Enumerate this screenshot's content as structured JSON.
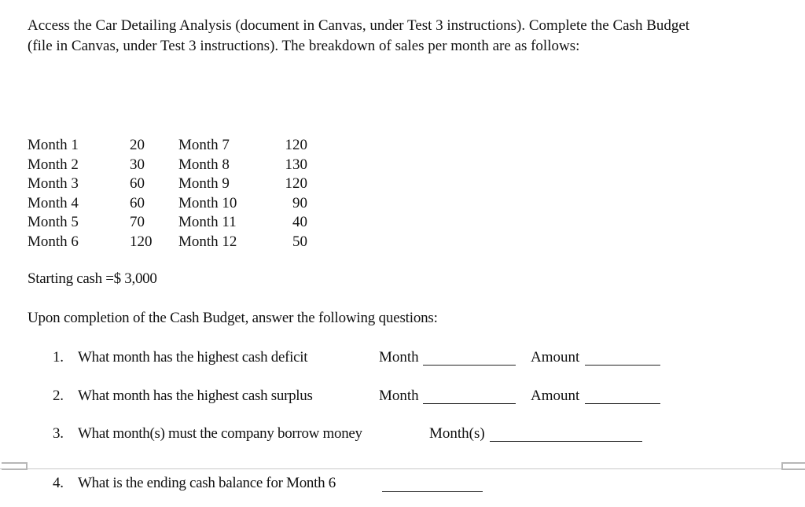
{
  "document": {
    "intro_paragraph": "Access the Car Detailing Analysis (document in Canvas, under Test 3 instructions). Complete the Cash Budget (file in Canvas, under Test 3 instructions). The breakdown of sales per month are as follows:",
    "sales": [
      {
        "month": "Month 1",
        "value": "20"
      },
      {
        "month": "Month 2",
        "value": "30"
      },
      {
        "month": "Month 3",
        "value": "60"
      },
      {
        "month": "Month 4",
        "value": "60"
      },
      {
        "month": "Month 5",
        "value": "70"
      },
      {
        "month": "Month 6",
        "value": "120"
      },
      {
        "month": "Month 7",
        "value": "120"
      },
      {
        "month": "Month 8",
        "value": "130"
      },
      {
        "month": "Month 9",
        "value": "120"
      },
      {
        "month": "Month 10",
        "value": "90"
      },
      {
        "month": "Month 11",
        "value": "40"
      },
      {
        "month": "Month 12",
        "value": "50"
      }
    ],
    "starting_cash": "Starting cash =$ 3,000",
    "questions_intro": "Upon completion of the Cash Budget, answer the following questions:",
    "questions": [
      {
        "number": "1.",
        "text": "What month has the highest cash deficit",
        "blanks": [
          "Month",
          "Amount"
        ]
      },
      {
        "number": "2.",
        "text": "What month has the highest cash surplus",
        "blanks": [
          "Month",
          "Amount"
        ]
      },
      {
        "number": "3.",
        "text": "What month(s) must the company borrow money",
        "blanks": [
          "Month(s)"
        ]
      },
      {
        "number": "4.",
        "text": "What is the ending cash balance for Month 6",
        "blanks": [
          ""
        ]
      }
    ]
  }
}
